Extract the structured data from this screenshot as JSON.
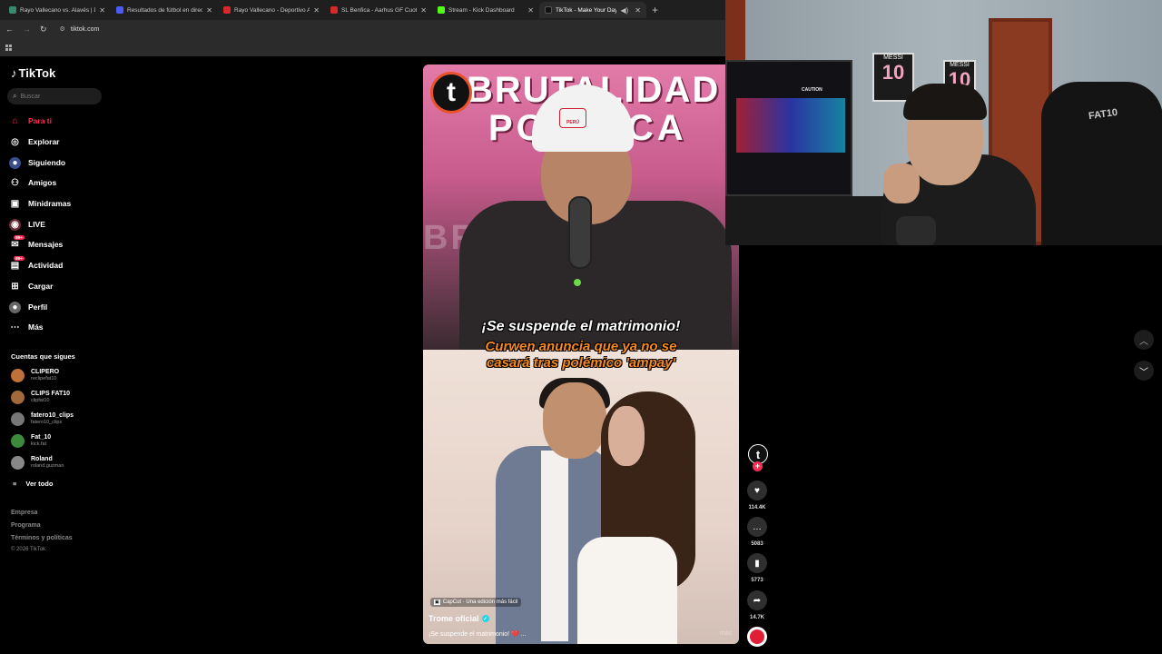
{
  "browser": {
    "tabs": [
      {
        "title": "Rayo Vallecano vs. Alavés | Dire",
        "color": "#3a8a6e",
        "active": false
      },
      {
        "title": "Resultados de fútbol en directo",
        "color": "#4a5cf5",
        "active": false
      },
      {
        "title": "Rayo Vallecano - Deportivo Ala",
        "color": "#d62a2a",
        "active": false
      },
      {
        "title": "SL Benfica - Aarhus GF Cuotas",
        "color": "#d62a2a",
        "active": false
      },
      {
        "title": "Stream - Kick Dashboard",
        "color": "#53fc18",
        "active": false
      },
      {
        "title": "TikTok - Make Your Day",
        "color": "#111111",
        "active": true
      }
    ],
    "url": "tiktok.com"
  },
  "sidebar": {
    "logo": "TikTok",
    "search_placeholder": "Buscar",
    "nav": [
      {
        "label": "Para ti",
        "icon": "home-icon",
        "active": true
      },
      {
        "label": "Explorar",
        "icon": "compass-icon",
        "active": false
      },
      {
        "label": "Siguiendo",
        "icon": "following-icon",
        "active": false
      },
      {
        "label": "Amigos",
        "icon": "friends-icon",
        "active": false
      },
      {
        "label": "Minidramas",
        "icon": "minidramas-icon",
        "active": false
      },
      {
        "label": "LIVE",
        "icon": "live-icon",
        "active": false
      },
      {
        "label": "Mensajes",
        "icon": "messages-icon",
        "active": false,
        "badge": "99+"
      },
      {
        "label": "Actividad",
        "icon": "activity-icon",
        "active": false,
        "badge": "99+"
      },
      {
        "label": "Cargar",
        "icon": "upload-icon",
        "active": false
      },
      {
        "label": "Perfil",
        "icon": "profile-icon",
        "active": false
      },
      {
        "label": "Más",
        "icon": "more-icon",
        "active": false
      }
    ],
    "following_title": "Cuentas que sigues",
    "following": [
      {
        "name": "CLIPERO",
        "handle": "reclipefat10",
        "color": "#c0703a"
      },
      {
        "name": "CLIPS FAT10",
        "handle": "clipfat10",
        "color": "#a06a3a"
      },
      {
        "name": "fatero10_clips",
        "handle": "fatero10_clips",
        "color": "#777777"
      },
      {
        "name": "Fat_10",
        "handle": "kick.fat",
        "color": "#3d8a3d"
      },
      {
        "name": "Roland",
        "handle": "roland.guzman",
        "color": "#888888"
      }
    ],
    "see_all": "Ver todo",
    "footer": [
      "Empresa",
      "Programa",
      "Términos y políticas"
    ],
    "copyright": "© 2026 TikTok"
  },
  "video": {
    "overlay_top_1": "BRUTALIDAD",
    "overlay_top_2": "POLÍTICA",
    "helmet_text": "PERÚ",
    "caption_headline": "¡Se suspende el matrimonio!",
    "caption_sub_1": "Curwen anuncia que ya no se",
    "caption_sub_2": "casará tras polémico 'ampay'",
    "capcut_label": "CapCut · Una edición más fácil",
    "author": "Trome oficial",
    "description": "¡Se suspende el matrimonio! 💔 ...",
    "more": "más"
  },
  "actions": {
    "likes": "114.4K",
    "comments": "5083",
    "saves": "5773",
    "shares": "14.7K"
  },
  "webcam": {
    "frame1": {
      "label": "MESSI",
      "number": "10"
    },
    "frame2": {
      "label": "MESSI",
      "number": "10"
    },
    "chair_label": "FAT10",
    "pc_label": "CAUTION"
  }
}
